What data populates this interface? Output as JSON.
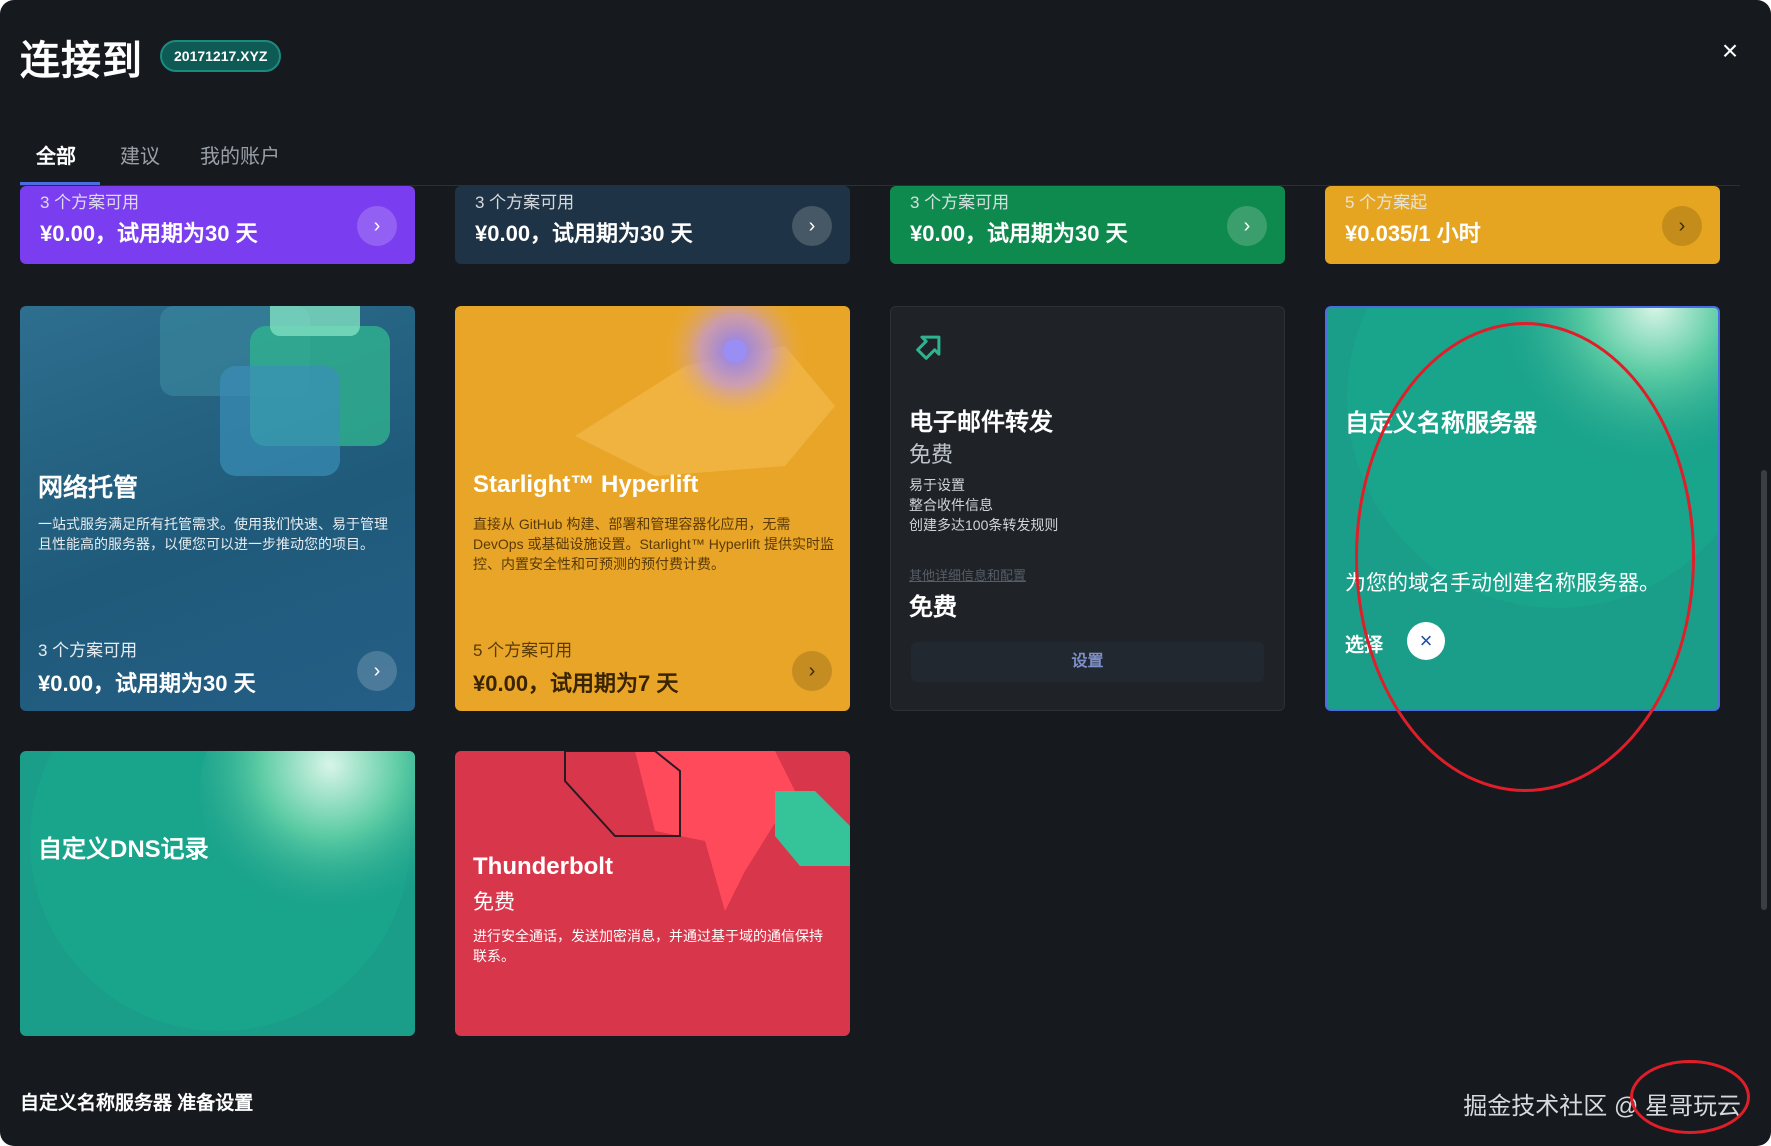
{
  "header": {
    "title": "连接到",
    "domain": "20171217.XYZ",
    "close_icon": "×"
  },
  "tabs": [
    {
      "label": "全部",
      "active": true
    },
    {
      "label": "建议",
      "active": false
    },
    {
      "label": "我的账户",
      "active": false
    }
  ],
  "top_strip": [
    {
      "count": "3 个方案可用",
      "price": "¥0.00，试用期为30 天",
      "color": "#7b3df0"
    },
    {
      "count": "3 个方案可用",
      "price": "¥0.00，试用期为30 天",
      "color": "#1e3345"
    },
    {
      "count": "3 个方案可用",
      "price": "¥0.00，试用期为30 天",
      "color": "#0f8a4e"
    },
    {
      "count": "5 个方案起",
      "price": "¥0.035/1 小时",
      "color": "#e6a520"
    }
  ],
  "hosting": {
    "title": "网络托管",
    "desc": "一站式服务满足所有托管需求。使用我们快速、易于管理且性能高的服务器，以便您可以进一步推动您的项目。",
    "count": "3 个方案可用",
    "price": "¥0.00，试用期为30 天"
  },
  "starlight": {
    "title": "Starlight™ Hyperlift",
    "desc": "直接从 GitHub 构建、部署和管理容器化应用，无需 DevOps 或基础设施设置。Starlight™ Hyperlift 提供实时监控、内置安全性和可预测的预付费计费。",
    "count": "5 个方案可用",
    "price": "¥0.00，试用期为7 天"
  },
  "email": {
    "title": "电子邮件转发",
    "subtitle": "免费",
    "features": [
      "易于设置",
      "整合收件信息",
      "创建多达100条转发规则"
    ],
    "link": "其他详细信息和配置",
    "price": "免费",
    "button": "设置"
  },
  "custom_ns": {
    "title": "自定义名称服务器",
    "desc": "为您的域名手动创建名称服务器。",
    "select_label": "选择",
    "close_icon": "×"
  },
  "custom_dns": {
    "title": "自定义DNS记录"
  },
  "thunderbolt": {
    "title": "Thunderbolt",
    "subtitle": "免费",
    "desc": "进行安全通话，发送加密消息，并通过基于域的通信保持联系。"
  },
  "footer": {
    "left": "自定义名称服务器 准备设置",
    "watermark": "掘金技术社区 @ 星哥玩云"
  },
  "colors": {
    "accent": "#4a6ee0",
    "annotation": "#e01e2a",
    "teal": "#1fae8f"
  }
}
